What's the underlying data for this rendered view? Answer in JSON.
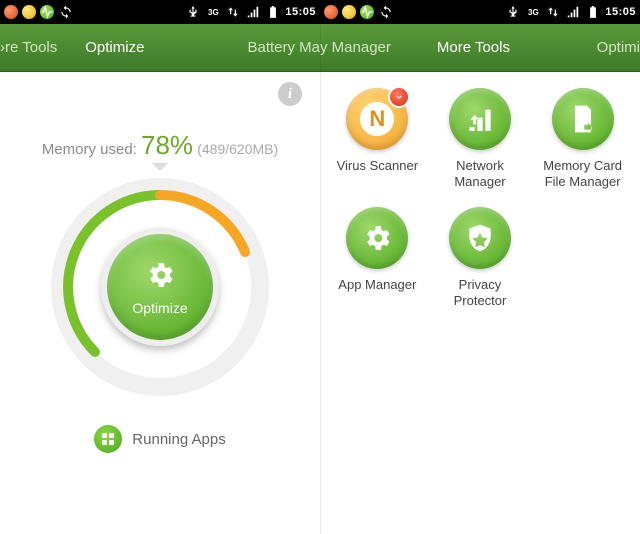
{
  "status": {
    "time": "15:05",
    "net_label": "3G"
  },
  "screen1": {
    "tabs": {
      "left_partial": "›re Tools",
      "selected": "Optimize",
      "right_partial": "Battery Ma"
    },
    "memory": {
      "label": "Memory used: ",
      "percent": "78%",
      "detail": "(489/620MB)"
    },
    "optimize_button": "Optimize",
    "running_apps": "Running Apps",
    "info_icon": "i"
  },
  "screen2": {
    "tabs": {
      "left_partial": "y Manager",
      "selected": "More Tools",
      "right_partial": "Optimi"
    },
    "tools": [
      {
        "id": "virus-scanner",
        "label": "Virus Scanner"
      },
      {
        "id": "network-manager",
        "label": "Network\nManager"
      },
      {
        "id": "memory-card-file-manager",
        "label": "Memory Card\nFile Manager"
      },
      {
        "id": "app-manager",
        "label": "App Manager"
      },
      {
        "id": "privacy-protector",
        "label": "Privacy\nProtector"
      }
    ]
  }
}
